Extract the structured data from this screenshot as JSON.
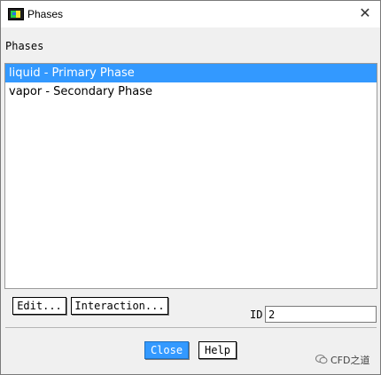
{
  "window": {
    "title": "Phases",
    "icon": "fluent-app-icon",
    "close_icon": "close-icon"
  },
  "phases": {
    "group_label": "Phases",
    "items": [
      {
        "label": "liquid - Primary Phase",
        "selected": true
      },
      {
        "label": "vapor - Secondary Phase",
        "selected": false
      }
    ]
  },
  "actions": {
    "edit_label": "Edit...",
    "interaction_label": "Interaction..."
  },
  "id_field": {
    "label": "ID",
    "value": "2"
  },
  "footer": {
    "close_label": "Close",
    "help_label": "Help"
  },
  "watermark": {
    "text": "CFD之道"
  },
  "colors": {
    "selection": "#3399ff",
    "background": "#f0f0f0"
  }
}
